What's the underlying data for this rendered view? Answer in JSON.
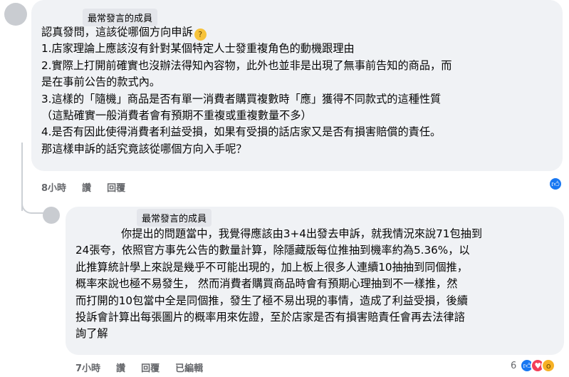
{
  "comment1": {
    "badge": "最常發言的成員",
    "line1": "認真發問，這該從哪個方向申訴",
    "line2": "1.店家理論上應該沒有針對某個特定人士發重複角色的動機跟理由",
    "line3": "2.實際上打開前確實也沒辦法得知內容物，此外也並非是出現了無事前告知的商品，而",
    "line4": "是在事前公告的款式內。",
    "line5": "3.這樣的「隨機」商品是否有單一消費者購買複數時「應」獲得不同款式的這種性質",
    "line6": "（這點確實一般消費者會有預期不重複或重複數量不多）",
    "line7": "4.是否有因此使得消費者利益受損，如果有受損的話店家又是否有損害賠償的責任。",
    "line8": "那這樣申訴的話究竟該從哪個方向入手呢？",
    "time": "8小時",
    "like_label": "讚",
    "reply_label": "回覆",
    "reactions": [
      "like-icon"
    ]
  },
  "comment2": {
    "badge": "最常發言的成員",
    "line1": "你提出的問題當中，我覺得應該由3+4出發去申訴，就我情況來說71包抽到",
    "line2": "24張夸，依照官方事先公告的數量計算，除隱藏版每位推抽到機率約為5.36%，以",
    "line3": "此推算統計學上來說是幾乎不可能出現的，加上板上很多人連續10抽抽到同個推，",
    "line4": "概率來說也極不易發生， 然而消費者購買商品時會有預期心理抽到不一樣推，然",
    "line5": "而打開的10包當中全是同個推，發生了極不易出現的事情，造成了利益受損，後續",
    "line6": "投訴會計算出每張圖片的概率用來佐證，至於店家是否有損害賠責任會再去法律諮",
    "line7": "詢了解",
    "time": "7小時",
    "like_label": "讚",
    "reply_label": "回覆",
    "edited_label": "已編輯",
    "reaction_count": "6",
    "reactions": [
      "like-icon",
      "love-icon",
      "wow-icon"
    ]
  },
  "colors": {
    "bubble": "#f0f2f5",
    "meta_text": "#65676b",
    "like": "#1877f2",
    "love": "#f33e58",
    "wow": "#f7b125"
  }
}
